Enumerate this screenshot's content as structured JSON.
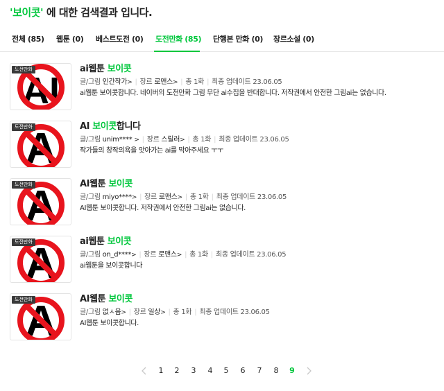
{
  "search": {
    "keyword": "'보이콧'",
    "heading_suffix": " 에 대한 검색결과 입니다."
  },
  "tabs": [
    {
      "label": "전체 (85)",
      "active": false
    },
    {
      "label": "웹툰 (0)",
      "active": false
    },
    {
      "label": "베스트도전 (0)",
      "active": false
    },
    {
      "label": "도전만화 (85)",
      "active": true
    },
    {
      "label": "단행본 만화 (0)",
      "active": false
    },
    {
      "label": "장르소설 (0)",
      "active": false
    }
  ],
  "labels": {
    "badge": "도전만화",
    "author_prefix": "글/그림",
    "genre_prefix": "장르",
    "episodes": "총 1화",
    "updated_prefix": "최종 업데이트",
    "arrow": ">"
  },
  "results": [
    {
      "title_pre": "ai웹툰 ",
      "title_hl": "보이콧",
      "title_post": "",
      "author": "인간작가",
      "genre": "로맨스",
      "date": "23.06.05",
      "desc": "ai웹툰 보이콧합니다. 네이버의 도전만화 그림 무단 ai수집을 반대합니다. 저작권에서 안전한 그림ai는 없습니다.",
      "thumb_text": "AI"
    },
    {
      "title_pre": "AI ",
      "title_hl": "보이콧",
      "title_post": "합니다",
      "author": "unim****",
      "genre": "스릴러",
      "date": "23.06.05",
      "desc": "작가들의 창작의욕을 앗아가는 ai를 막아주세요 ㅜㅜ",
      "thumb_text": "A"
    },
    {
      "title_pre": "AI웹툰 ",
      "title_hl": "보이콧",
      "title_post": "",
      "author": "miyo****",
      "genre": "로맨스",
      "date": "23.06.05",
      "desc": "AI웹툰 보이콧합니다. 저작권에서 안전한 그림ai는 없습니다.",
      "thumb_text": "A"
    },
    {
      "title_pre": "ai웹툰 ",
      "title_hl": "보이콧",
      "title_post": "",
      "author": "on_d****",
      "genre": "로맨스",
      "date": "23.06.05",
      "desc": "ai웹툰을 보이콧합니다",
      "thumb_text": "A"
    },
    {
      "title_pre": "AI웹툰 ",
      "title_hl": "보이콧",
      "title_post": "",
      "author": "없ㅅ음",
      "genre": "일상",
      "date": "23.06.05",
      "desc": "AI웹툰 보이콧합니다.",
      "thumb_text": "A"
    }
  ],
  "pagination": {
    "pages": [
      "1",
      "2",
      "3",
      "4",
      "5",
      "6",
      "7",
      "8",
      "9"
    ],
    "current": "9"
  },
  "colors": {
    "accent": "#00c73c",
    "ban_red": "#e8141d",
    "badge_bg": "#3a3a3a"
  }
}
